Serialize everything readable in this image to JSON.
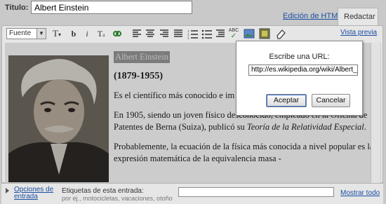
{
  "title": {
    "label": "Titulo:",
    "value": "Albert Einstein"
  },
  "tabs": {
    "html": "Edición de HTML",
    "compose": "Redactar"
  },
  "toolbar": {
    "font": "Fuente",
    "preview": "Vista previa"
  },
  "post": {
    "heading": "Albert Einstein",
    "years": "(1879-1955)",
    "p1": "Es el científico más conocido e im Alemania ya se nacionalizó en Es",
    "p2_a": "En 1905, siendo un joven físico desconocido, empleado en la Oficina de Patentes de Berna (Suiza), publicó su ",
    "p2_b": "Teoría de la Relatividad Especial",
    "p2_c": ".",
    "p3": "Probablemente, la ecuación de la física más conocida a nivel popular es la expresión matemática de la equivalencia masa -"
  },
  "footer": {
    "options": "Opciones de entrada",
    "labels_title": "Etiquetas de esta entrada:",
    "labels_hint": "por ej., motocicletas, vacaciones, otoño",
    "show_all": "Mostrar todo"
  },
  "dialog": {
    "title": "Escribe una URL:",
    "url": "http://es.wikipedia.org/wiki/Albert_",
    "ok": "Aceptar",
    "cancel": "Cancelar"
  },
  "colors": {
    "link": "#1a4ea5",
    "focus": "#3d6fcf"
  }
}
